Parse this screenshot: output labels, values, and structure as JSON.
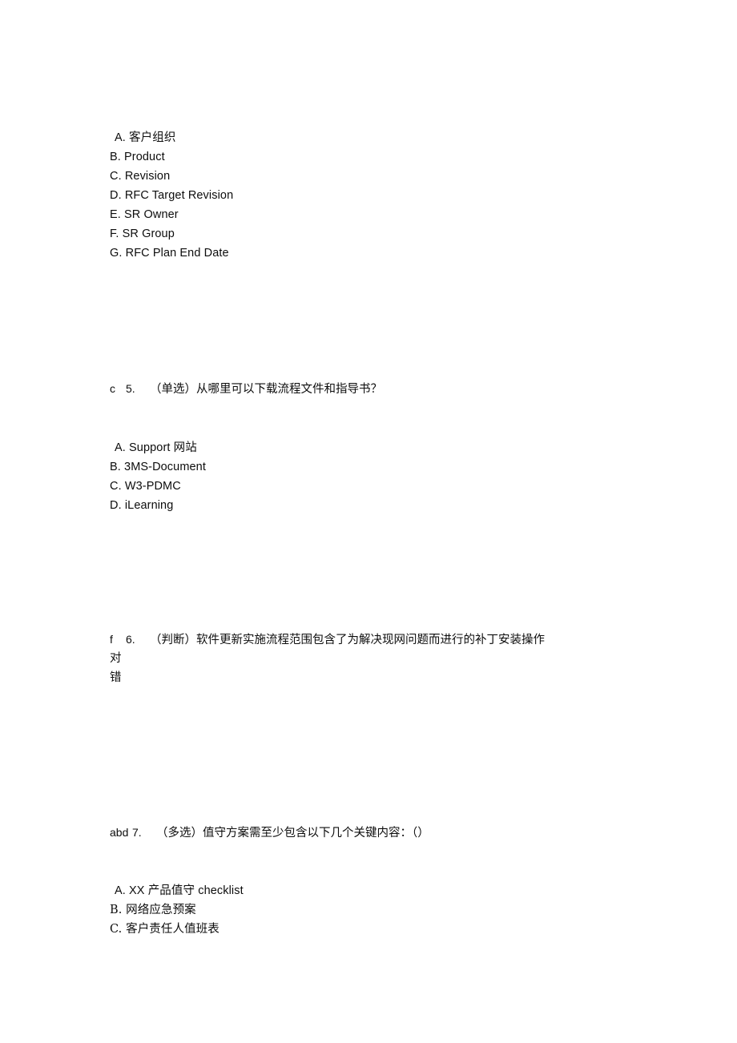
{
  "document": {
    "page_background": "#ffffff",
    "text_color": "#0d0d0d"
  },
  "question_4_options": {
    "items": [
      "A. 客户组织",
      "B. Product",
      "C. Revision",
      "D. RFC Target Revision",
      "E. SR Owner",
      "F. SR Group",
      "G. RFC Plan End Date"
    ]
  },
  "question_5": {
    "answer_mark": "c",
    "number": "5.",
    "text": "（单选）从哪里可以下载流程文件和指导书？",
    "options": [
      "A. Support 网站",
      "B. 3MS-Document",
      "C. W3-PDMC",
      "D. iLearning"
    ]
  },
  "question_6": {
    "answer_mark": "f",
    "number": "6.",
    "text": "（判断）软件更新实施流程范围包含了为解决现网问题而进行的补丁安装操作",
    "choices": [
      "对",
      "错"
    ]
  },
  "question_7": {
    "answer_mark": "abd",
    "number": "7.",
    "text": "（多选）值守方案需至少包含以下几个关键内容：（）",
    "options": [
      "A. XX 产品值守 checklist",
      "B. 网络应急预案",
      "C. 客户责任人值班表"
    ]
  }
}
